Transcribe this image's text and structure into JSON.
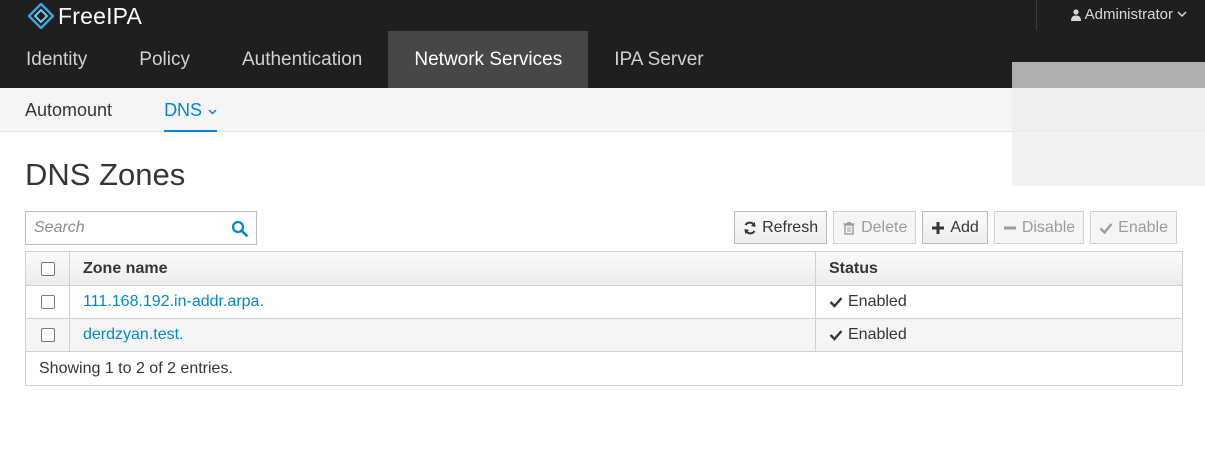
{
  "brand": {
    "name": "FreeIPA"
  },
  "user_menu": {
    "label": "Administrator"
  },
  "nav_primary": [
    {
      "label": "Identity",
      "active": false
    },
    {
      "label": "Policy",
      "active": false
    },
    {
      "label": "Authentication",
      "active": false
    },
    {
      "label": "Network Services",
      "active": true
    },
    {
      "label": "IPA Server",
      "active": false
    }
  ],
  "nav_secondary": [
    {
      "label": "Automount",
      "active": false
    },
    {
      "label": "DNS",
      "active": true
    }
  ],
  "page": {
    "title": "DNS Zones"
  },
  "search": {
    "placeholder": "Search",
    "value": ""
  },
  "toolbar": {
    "refresh": "Refresh",
    "delete": "Delete",
    "add": "Add",
    "disable": "Disable",
    "enable": "Enable"
  },
  "table": {
    "columns": {
      "name": "Zone name",
      "status": "Status"
    },
    "rows": [
      {
        "name": "111.168.192.in-addr.arpa.",
        "status": "Enabled"
      },
      {
        "name": "derdzyan.test.",
        "status": "Enabled"
      }
    ],
    "footer": "Showing 1 to 2 of 2 entries."
  },
  "colors": {
    "accent": "#0088ce",
    "topbar": "#1f1f1f",
    "active_tab": "#474747"
  }
}
